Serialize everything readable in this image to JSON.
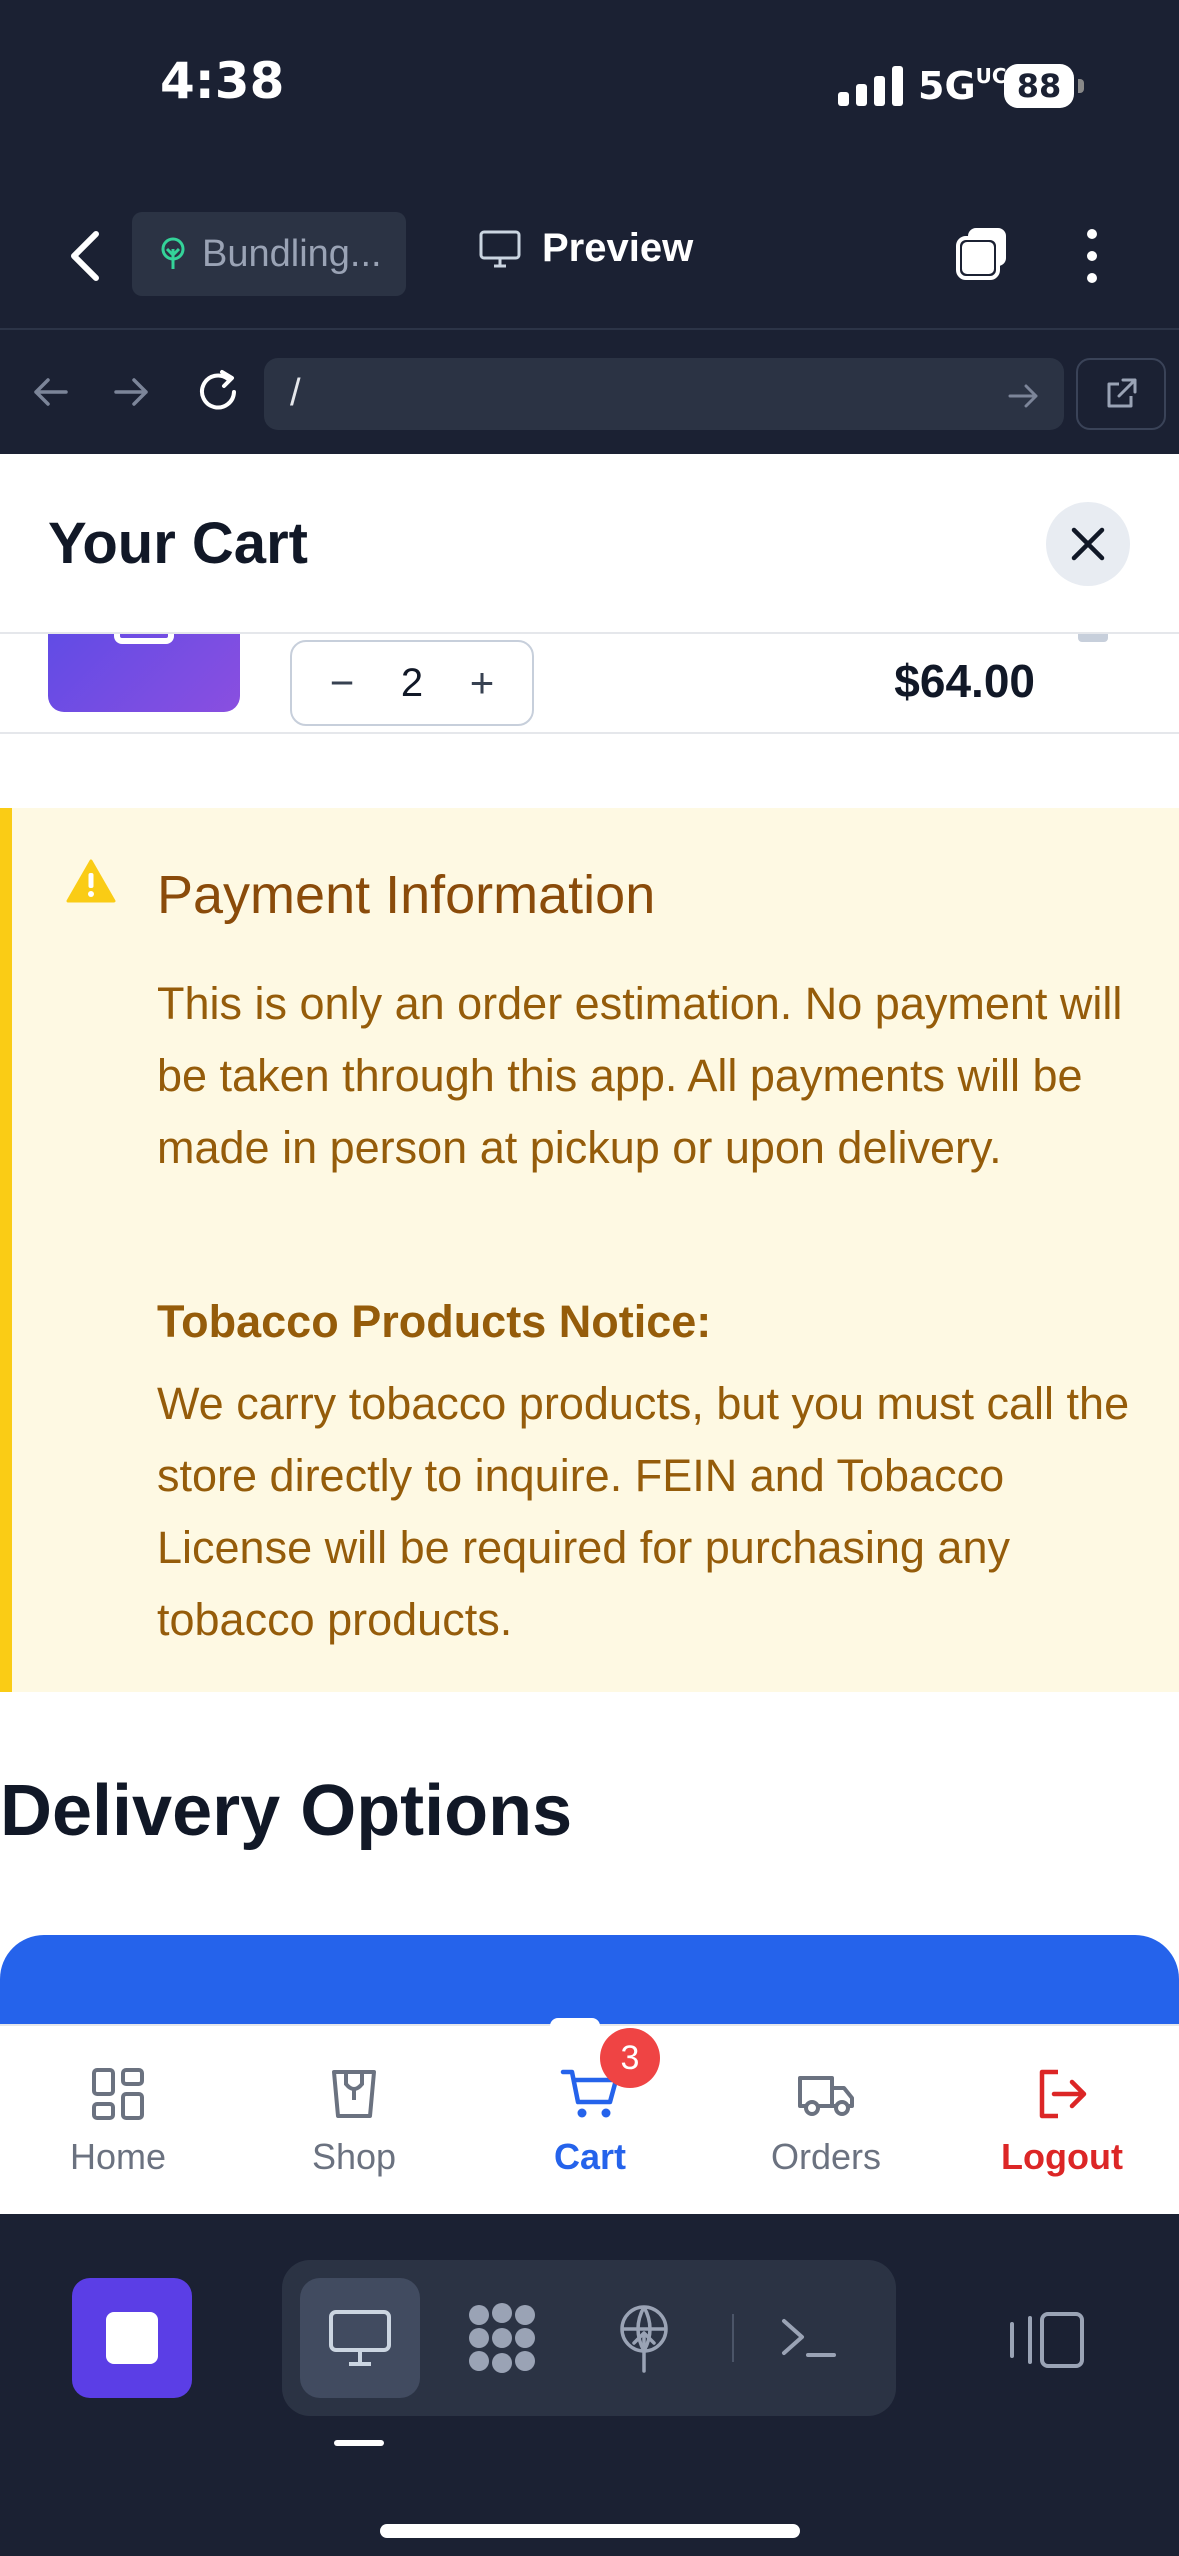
{
  "status_bar": {
    "time": "4:38",
    "network": "5G",
    "network_sup": "UC",
    "battery": "88"
  },
  "editor": {
    "project_name": "Bundling...",
    "preview_label": "Preview",
    "url_path": "/"
  },
  "cart": {
    "title": "Your Cart",
    "item": {
      "quantity": "2",
      "decrement": "−",
      "increment": "+",
      "price": "$64.00"
    }
  },
  "notice": {
    "title": "Payment Information",
    "body": "This is only an order estimation. No payment will be taken through this app. All payments will be made in person at pickup or upon delivery.",
    "tobacco_title": "Tobacco Products Notice:",
    "tobacco_body": "We carry tobacco products, but you must call the store directly to inquire. FEIN and Tobacco License will be required for purchasing any tobacco products."
  },
  "delivery": {
    "title": "Delivery Options"
  },
  "bottom_nav": {
    "items": [
      {
        "label": "Home",
        "icon": "grid-icon"
      },
      {
        "label": "Shop",
        "icon": "shopping-bag-icon"
      },
      {
        "label": "Cart",
        "icon": "cart-icon",
        "badge": "3",
        "active": true
      },
      {
        "label": "Orders",
        "icon": "truck-icon"
      },
      {
        "label": "Logout",
        "icon": "logout-icon"
      }
    ]
  },
  "colors": {
    "accent": "#2563eb",
    "danger": "#dc2626",
    "warning_bg": "#fef9e3",
    "warning_border": "#facc15",
    "warning_text": "#955c0a",
    "dark_bg": "#1b2133"
  }
}
